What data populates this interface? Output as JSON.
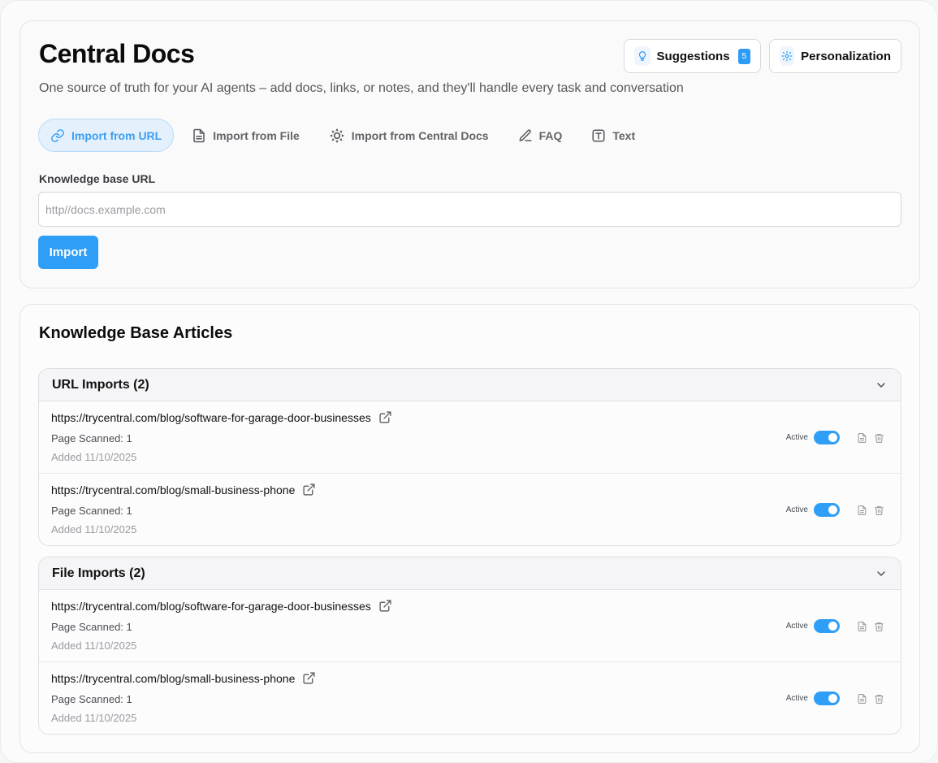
{
  "header": {
    "title": "Central Docs",
    "subtitle": "One source of truth for your AI agents – add docs, links, or notes, and they'll handle every task and conversation",
    "suggestions_label": "Suggestions",
    "suggestions_count": "5",
    "personalization_label": "Personalization"
  },
  "tabs": [
    {
      "label": "Import from URL",
      "icon": "link-icon",
      "active": true
    },
    {
      "label": "Import from File",
      "icon": "file-icon",
      "active": false
    },
    {
      "label": "Import from Central Docs",
      "icon": "central-logo-icon",
      "active": false
    },
    {
      "label": "FAQ",
      "icon": "pencil-icon",
      "active": false
    },
    {
      "label": "Text",
      "icon": "text-t-icon",
      "active": false
    }
  ],
  "import_form": {
    "label": "Knowledge base URL",
    "placeholder": "http//docs.example.com",
    "value": "",
    "button_label": "Import"
  },
  "kb": {
    "title": "Knowledge Base Articles",
    "sections": [
      {
        "title": "URL Imports (2)",
        "items": [
          {
            "url": "https://trycentral.com/blog/software-for-garage-door-businesses",
            "scanned": "Page Scanned: 1",
            "added": "Added 11/10/2025",
            "status": "Active",
            "active": true
          },
          {
            "url": "https://trycentral.com/blog/small-business-phone",
            "scanned": "Page Scanned: 1",
            "added": "Added 11/10/2025",
            "status": "Active",
            "active": true
          }
        ]
      },
      {
        "title": "File Imports (2)",
        "items": [
          {
            "url": "https://trycentral.com/blog/software-for-garage-door-businesses",
            "scanned": "Page Scanned: 1",
            "added": "Added 11/10/2025",
            "status": "Active",
            "active": true
          },
          {
            "url": "https://trycentral.com/blog/small-business-phone",
            "scanned": "Page Scanned: 1",
            "added": "Added 11/10/2025",
            "status": "Active",
            "active": true
          }
        ]
      }
    ]
  },
  "colors": {
    "accent": "#2e9ef6",
    "accent_light": "#e4f1fd",
    "text_primary": "#111111",
    "text_muted": "#9a9ca1"
  }
}
